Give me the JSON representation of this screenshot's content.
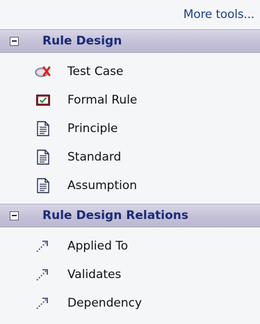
{
  "toolbar": {
    "more_tools": "More tools..."
  },
  "sections": [
    {
      "title": "Rule Design",
      "expanded": true,
      "items": [
        {
          "label": "Test Case",
          "icon": "test-case-icon"
        },
        {
          "label": "Formal Rule",
          "icon": "formal-rule-icon"
        },
        {
          "label": "Principle",
          "icon": "document-icon"
        },
        {
          "label": "Standard",
          "icon": "document-icon"
        },
        {
          "label": "Assumption",
          "icon": "document-icon"
        }
      ]
    },
    {
      "title": "Rule Design Relations",
      "expanded": true,
      "items": [
        {
          "label": "Applied To",
          "icon": "dashed-arrow-icon"
        },
        {
          "label": "Validates",
          "icon": "dashed-arrow-icon"
        },
        {
          "label": "Dependency",
          "icon": "dashed-arrow-icon"
        }
      ]
    }
  ],
  "colors": {
    "header_title": "#1a2a78",
    "link": "#1c3f8f",
    "background": "#f5f6f7"
  }
}
